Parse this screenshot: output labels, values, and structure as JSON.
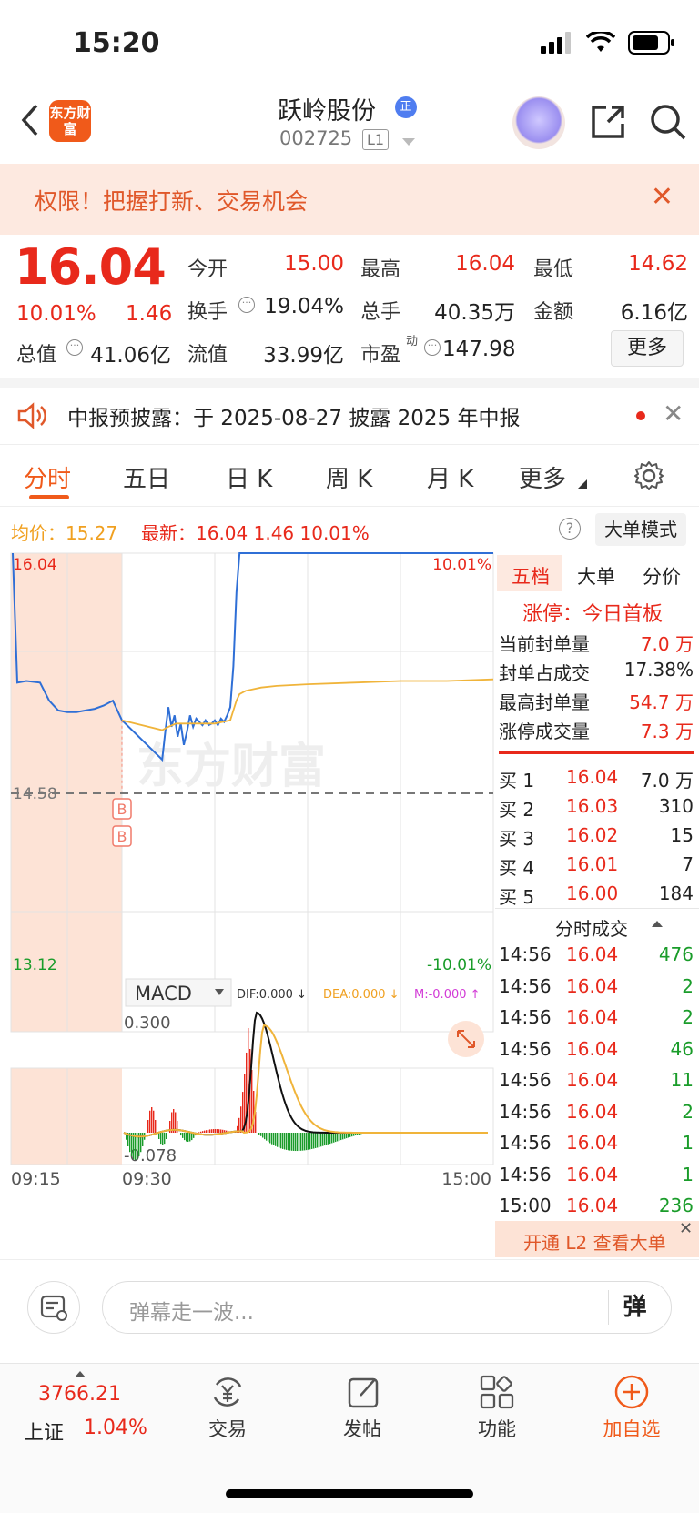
{
  "status_bar": {
    "time": "15:20"
  },
  "nav": {
    "brand_logo": "东方财富",
    "stock_name": "跃岭股份",
    "stock_badge": "正",
    "stock_code": "002725",
    "level": "L1"
  },
  "banner": {
    "text": "权限！把握打新、交易机会"
  },
  "quote": {
    "price": "16.04",
    "change_pct": "10.01%",
    "change": "1.46",
    "open_label": "今开",
    "open": "15.00",
    "high_label": "最高",
    "high": "16.04",
    "low_label": "最低",
    "low": "14.62",
    "turnover_label": "换手",
    "turnover": "19.04%",
    "volume_label": "总手",
    "volume": "40.35万",
    "amount_label": "金额",
    "amount": "6.16亿",
    "mktcap_label": "总值",
    "mktcap": "41.06亿",
    "float_label": "流值",
    "float": "33.99亿",
    "pe_label": "市盈",
    "pe_sup": "动",
    "pe": "147.98",
    "more_label": "更多"
  },
  "notice": {
    "text": "中报预披露：于 2025-08-27 披露 2025 年中报"
  },
  "tabs": [
    "分时",
    "五日",
    "日 K",
    "周 K",
    "月 K",
    "更多"
  ],
  "chart_header": {
    "avg_label": "均价：15.27",
    "latest_label": "最新：16.04  1.46  10.01%",
    "bigorder_btn": "大单模式"
  },
  "chart_data": {
    "type": "line",
    "title": "",
    "y_max_label": "16.04",
    "y_mid_label": "14.58",
    "y_min_label": "13.12",
    "pct_max_label": "10.01%",
    "pct_min_label": "-10.01%",
    "ylim": [
      13.12,
      16.04
    ],
    "prev_close": 14.58,
    "x_labels": [
      "09:15",
      "09:30",
      "15:00"
    ],
    "watermark": "东方财富",
    "markers": [
      "B",
      "B"
    ],
    "series": [
      {
        "name": "price",
        "color": "#2f6fd6",
        "x": [
          0,
          1,
          3,
          6,
          8,
          10,
          12,
          14,
          16,
          18,
          20,
          22,
          24,
          26,
          28,
          30,
          32,
          34,
          36,
          38,
          40,
          42,
          44,
          46,
          48,
          50,
          52,
          54,
          56,
          58,
          60,
          62,
          64,
          66,
          68,
          70,
          72,
          74,
          76,
          78,
          80,
          82,
          85,
          90,
          100,
          120,
          140,
          160,
          180,
          200,
          220,
          240
        ],
        "y": [
          16.04,
          15.25,
          15.26,
          15.25,
          15.14,
          15.08,
          15.07,
          15.07,
          15.08,
          15.09,
          15.11,
          15.14,
          15.02,
          14.78,
          14.95,
          15.1,
          14.98,
          15.05,
          14.92,
          15.0,
          14.87,
          14.95,
          15.05,
          14.98,
          15.03,
          15.01,
          14.99,
          15.02,
          14.99,
          15.0,
          15.02,
          14.99,
          15.03,
          15.01,
          15.05,
          15.1,
          15.35,
          15.8,
          16.04,
          16.04,
          16.04,
          16.04,
          16.04,
          16.04,
          16.04,
          16.04,
          16.04,
          16.04,
          16.04,
          16.04,
          16.04,
          16.04
        ]
      },
      {
        "name": "avg",
        "color": "#f0b43a",
        "x": [
          24,
          26,
          30,
          35,
          40,
          45,
          50,
          55,
          60,
          65,
          70,
          72,
          74,
          76,
          80,
          90,
          100,
          120,
          150,
          180,
          210,
          240
        ],
        "y": [
          15.02,
          14.96,
          14.98,
          15.0,
          15.0,
          15.0,
          15.0,
          15.0,
          15.0,
          15.01,
          15.02,
          15.08,
          15.14,
          15.18,
          15.2,
          15.22,
          15.23,
          15.24,
          15.25,
          15.26,
          15.26,
          15.27
        ]
      }
    ],
    "macd": {
      "label": "MACD",
      "dif": "DIF:0.000 ↓",
      "dea": "DEA:0.000 ↓",
      "m": "M:-0.000 ↑",
      "y_top_label": "0.300",
      "y_bottom_label": "-0.078"
    }
  },
  "right_panel": {
    "tabs": [
      "五档",
      "大单",
      "分价"
    ],
    "limit_title": "涨停：今日首板",
    "stats": [
      {
        "label": "当前封单量",
        "value": "7.0 万"
      },
      {
        "label": "封单占成交",
        "value": "17.38%"
      },
      {
        "label": "最高封单量",
        "value": "54.7 万"
      },
      {
        "label": "涨停成交量",
        "value": "7.3 万"
      }
    ],
    "bids": [
      {
        "label": "买 1",
        "price": "16.04",
        "vol": "7.0 万"
      },
      {
        "label": "买 2",
        "price": "16.03",
        "vol": "310"
      },
      {
        "label": "买 3",
        "price": "16.02",
        "vol": "15"
      },
      {
        "label": "买 4",
        "price": "16.01",
        "vol": "7"
      },
      {
        "label": "买 5",
        "price": "16.00",
        "vol": "184"
      }
    ],
    "ticks_title": "分时成交",
    "ticks": [
      {
        "time": "14:56",
        "price": "16.04",
        "vol": "476"
      },
      {
        "time": "14:56",
        "price": "16.04",
        "vol": "2"
      },
      {
        "time": "14:56",
        "price": "16.04",
        "vol": "2"
      },
      {
        "time": "14:56",
        "price": "16.04",
        "vol": "46"
      },
      {
        "time": "14:56",
        "price": "16.04",
        "vol": "11"
      },
      {
        "time": "14:56",
        "price": "16.04",
        "vol": "2"
      },
      {
        "time": "14:56",
        "price": "16.04",
        "vol": "1"
      },
      {
        "time": "14:56",
        "price": "16.04",
        "vol": "1"
      },
      {
        "time": "15:00",
        "price": "16.04",
        "vol": "236"
      }
    ],
    "l2_link": "开通 L2 查看大单"
  },
  "comment": {
    "placeholder": "弹幕走一波...",
    "danmu_label": "弹"
  },
  "tabbar": {
    "index_value": "3766.21",
    "index_name": "上证",
    "index_pct": "1.04%",
    "items": [
      "交易",
      "发帖",
      "功能",
      "加自选"
    ]
  }
}
